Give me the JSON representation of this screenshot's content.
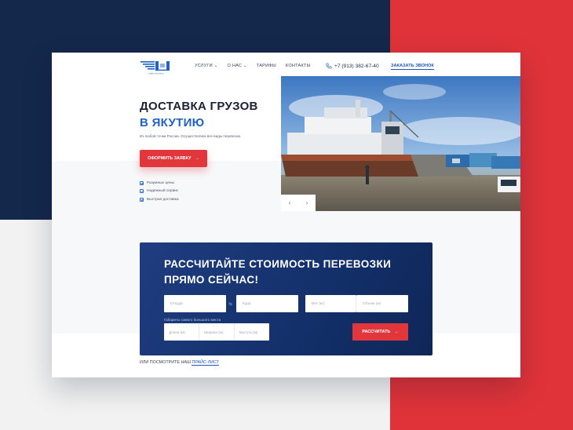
{
  "colors": {
    "navy": "#14284b",
    "red": "#df3339",
    "accent_blue": "#1f63c9",
    "button_red": "#e0363c"
  },
  "logo": {
    "caption": "ТРАНС-ЭКСПРЕСС"
  },
  "nav": {
    "items": [
      {
        "label": "УСЛУГИ",
        "has_dropdown": true
      },
      {
        "label": "О НАС",
        "has_dropdown": true
      },
      {
        "label": "ТАРИФЫ",
        "has_dropdown": false
      },
      {
        "label": "КОНТАКТЫ",
        "has_dropdown": false
      }
    ],
    "chevron": "⌄",
    "phone": "+7 (913) 382-67-40",
    "phone_icon": "phone-icon",
    "callback": "ЗАКАЗАТЬ ЗВОНОК"
  },
  "hero": {
    "title_line1": "ДОСТАВКА ГРУЗОВ",
    "title_line2": "В ЯКУТИЮ",
    "lead": "Из любой точки России. Осуществляем все виды перевозок.",
    "cta": "ОФОРМИТЬ ЗАЯВКУ",
    "arrow": "→",
    "features": [
      "Разумные цены",
      "Надежный сервис",
      "Быстрая доставка"
    ],
    "slider_prev": "‹",
    "slider_next": "›"
  },
  "calculator": {
    "title_line1": "РАССЧИТАЙТЕ СТОИМОСТЬ ПЕРЕВОЗКИ",
    "title_line2": "ПРЯМО СЕЙЧАС!",
    "from_placeholder": "Откуда",
    "to_placeholder": "Куда",
    "swap_icon": "⇆",
    "weight_placeholder": "Вес (кг)",
    "volume_placeholder": "Объем (м)",
    "dims_label": "Габариты самого большого места",
    "length_placeholder": "Длина (м)",
    "width_placeholder": "Ширина (м)",
    "height_placeholder": "Высота (м)",
    "submit": "РАССЧИТАТЬ",
    "arrow": "→"
  },
  "footer_link": {
    "prefix": "ИЛИ ПОСМОТРИТЕ НАШ ",
    "link": "ПРАЙС-ЛИСТ"
  }
}
